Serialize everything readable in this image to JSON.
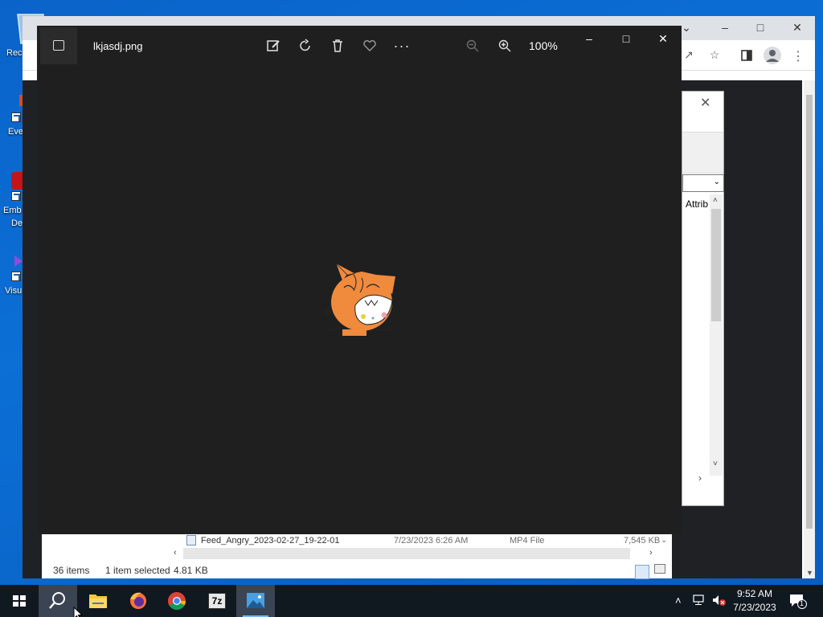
{
  "desktop": {
    "icons": [
      {
        "label": "Rec",
        "top": 0
      },
      {
        "label": "Eve",
        "top": 0
      },
      {
        "label": "Emb",
        "label2": "De"
      },
      {
        "label": "Visu"
      }
    ]
  },
  "browser_back": {
    "right_partial_text": "Attrib"
  },
  "explorer": {
    "file_row": {
      "name": "Feed_Angry_2023-02-27_19-22-01",
      "date": "7/23/2023 6:26 AM",
      "type": "MP4 File",
      "size": "7,545 KB"
    },
    "status": {
      "items": "36 items",
      "selected": "1 item selected",
      "size": "4.81 KB"
    }
  },
  "photos": {
    "filename": "lkjasdj.png",
    "zoom": "100%"
  },
  "taskbar": {
    "apps": [
      "start",
      "search",
      "file-explorer",
      "firefox",
      "chrome",
      "7-zip",
      "photos"
    ],
    "sevenzip_label": "7z",
    "time": "9:52 AM",
    "date": "7/23/2023",
    "notification_count": "1"
  },
  "colors": {
    "viewer_bg": "#1f1f1f",
    "taskbar_bg": "#101820",
    "desktop_blue": "#0b6fd6",
    "cat_orange": "#f08a3c"
  }
}
